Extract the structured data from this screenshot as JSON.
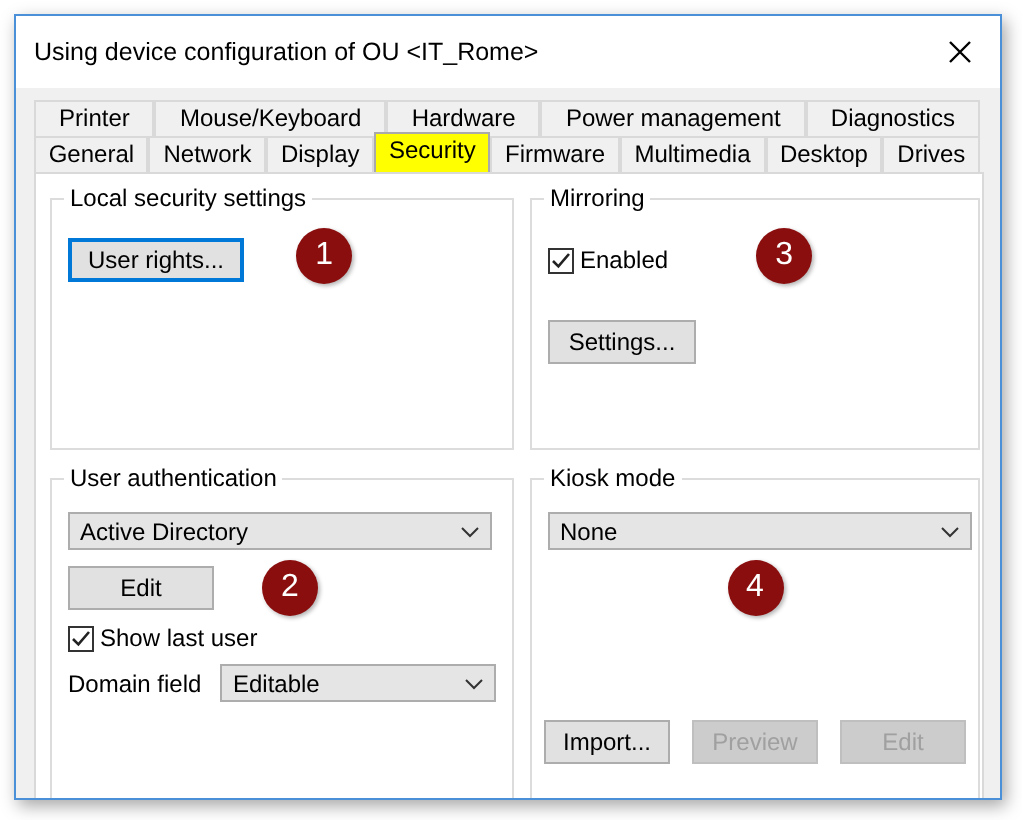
{
  "window": {
    "title": "Using device configuration of OU <IT_Rome>"
  },
  "tab_rows": [
    [
      {
        "label": "Printer",
        "selected": false
      },
      {
        "label": "Mouse/Keyboard",
        "selected": false
      },
      {
        "label": "Hardware",
        "selected": false
      },
      {
        "label": "Power management",
        "selected": false
      },
      {
        "label": "Diagnostics",
        "selected": false
      }
    ],
    [
      {
        "label": "General",
        "selected": false
      },
      {
        "label": "Network",
        "selected": false
      },
      {
        "label": "Display",
        "selected": false
      },
      {
        "label": "Security",
        "selected": true
      },
      {
        "label": "Firmware",
        "selected": false
      },
      {
        "label": "Multimedia",
        "selected": false
      },
      {
        "label": "Desktop",
        "selected": false
      },
      {
        "label": "Drives",
        "selected": false
      }
    ]
  ],
  "local_security": {
    "title": "Local security settings",
    "button": "User rights...",
    "callout": "1"
  },
  "mirroring": {
    "title": "Mirroring",
    "checkbox": {
      "label": "Enabled",
      "checked": true
    },
    "button": "Settings...",
    "callout": "3"
  },
  "user_authentication": {
    "title": "User authentication",
    "dropdown": "Active Directory",
    "button": "Edit",
    "callout": "2",
    "checkbox": {
      "label": "Show last user",
      "checked": true
    },
    "domain_field": {
      "label": "Domain field",
      "value": "Editable"
    }
  },
  "kiosk_mode": {
    "title": "Kiosk mode",
    "dropdown": "None",
    "callout": "4",
    "buttons": [
      {
        "label": "Import...",
        "disabled": false
      },
      {
        "label": "Preview",
        "disabled": true
      },
      {
        "label": "Edit",
        "disabled": true
      }
    ]
  }
}
